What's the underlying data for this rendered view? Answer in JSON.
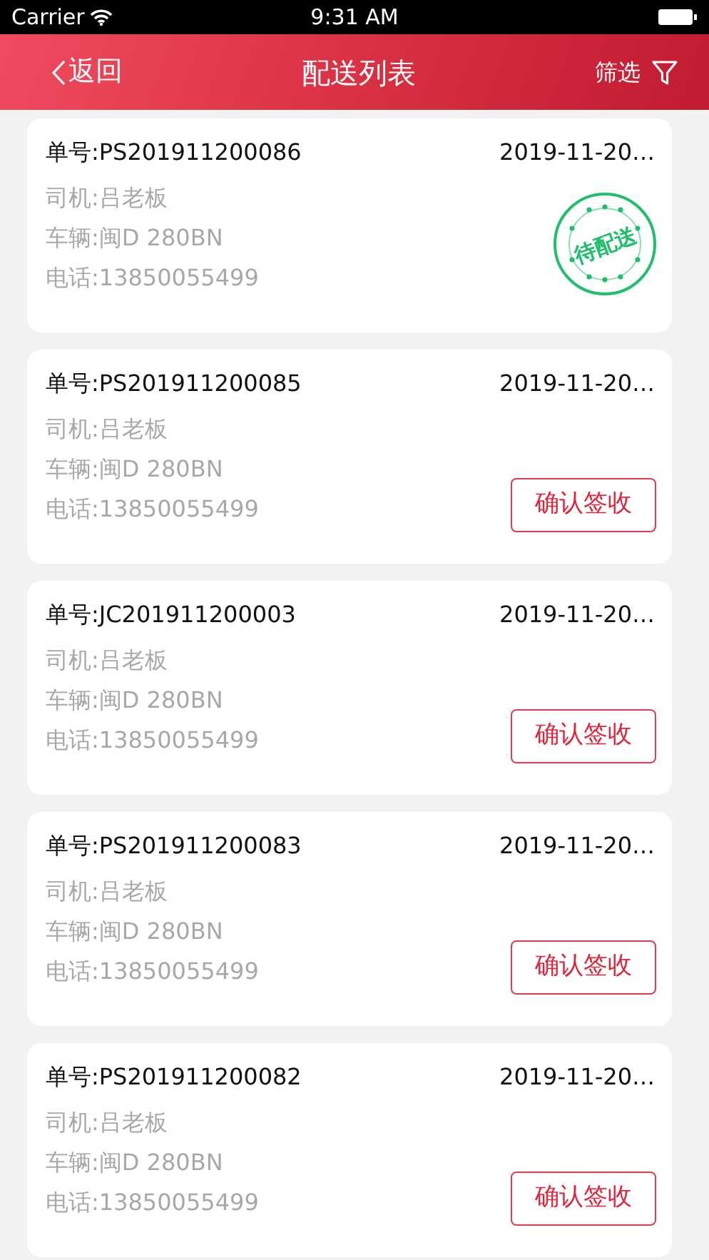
{
  "status_bar": {
    "carrier": "Carrier",
    "time": "9:31 AM"
  },
  "nav": {
    "back": "返回",
    "title": "配送列表",
    "filter": "筛选"
  },
  "orders": [
    {
      "number": "单号:PS201911200086",
      "date": "2019-11-20…",
      "driver": "司机:吕老板",
      "vehicle": "车辆:闽D 280BN",
      "phone": "电话:13850055499",
      "action": {
        "kind": "stamp",
        "label": "待配送"
      }
    },
    {
      "number": "单号:PS201911200085",
      "date": "2019-11-20…",
      "driver": "司机:吕老板",
      "vehicle": "车辆:闽D 280BN",
      "phone": "电话:13850055499",
      "action": {
        "kind": "button",
        "label": "确认签收"
      }
    },
    {
      "number": "单号:JC201911200003",
      "date": "2019-11-20…",
      "driver": "司机:吕老板",
      "vehicle": "车辆:闽D 280BN",
      "phone": "电话:13850055499",
      "action": {
        "kind": "button",
        "label": "确认签收"
      }
    },
    {
      "number": "单号:PS201911200083",
      "date": "2019-11-20…",
      "driver": "司机:吕老板",
      "vehicle": "车辆:闽D 280BN",
      "phone": "电话:13850055499",
      "action": {
        "kind": "button",
        "label": "确认签收"
      }
    },
    {
      "number": "单号:PS201911200082",
      "date": "2019-11-20…",
      "driver": "司机:吕老板",
      "vehicle": "车辆:闽D 280BN",
      "phone": "电话:13850055499",
      "action": {
        "kind": "button",
        "label": "确认签收"
      }
    }
  ]
}
